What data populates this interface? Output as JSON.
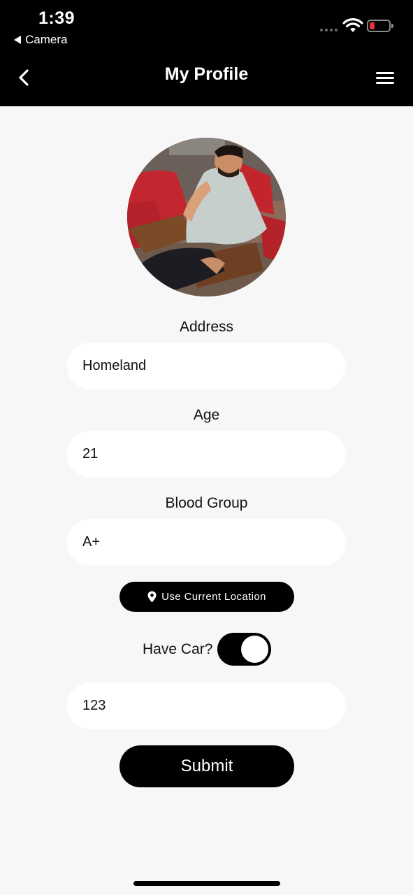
{
  "status_bar": {
    "time": "1:39",
    "back_app": "Camera",
    "battery_color": "#e4343a"
  },
  "header": {
    "title": "My Profile",
    "back_icon": "chevron-left-icon",
    "menu_icon": "hamburger-menu-icon"
  },
  "profile": {
    "avatar": "profile-photo"
  },
  "form": {
    "address_label": "Address",
    "address_value": "Homeland",
    "age_label": "Age",
    "age_value": "21",
    "blood_group_label": "Blood Group",
    "blood_group_value": "A+",
    "location_button_label": "Use Current Location",
    "location_icon": "map-pin-icon",
    "have_car_label": "Have Car?",
    "have_car_on": true,
    "car_field_value": "123",
    "submit_label": "Submit"
  },
  "theme": {
    "background": "#f7f7f7",
    "header_bg": "#000000",
    "field_bg": "#ffffff",
    "button_bg": "#000000"
  }
}
